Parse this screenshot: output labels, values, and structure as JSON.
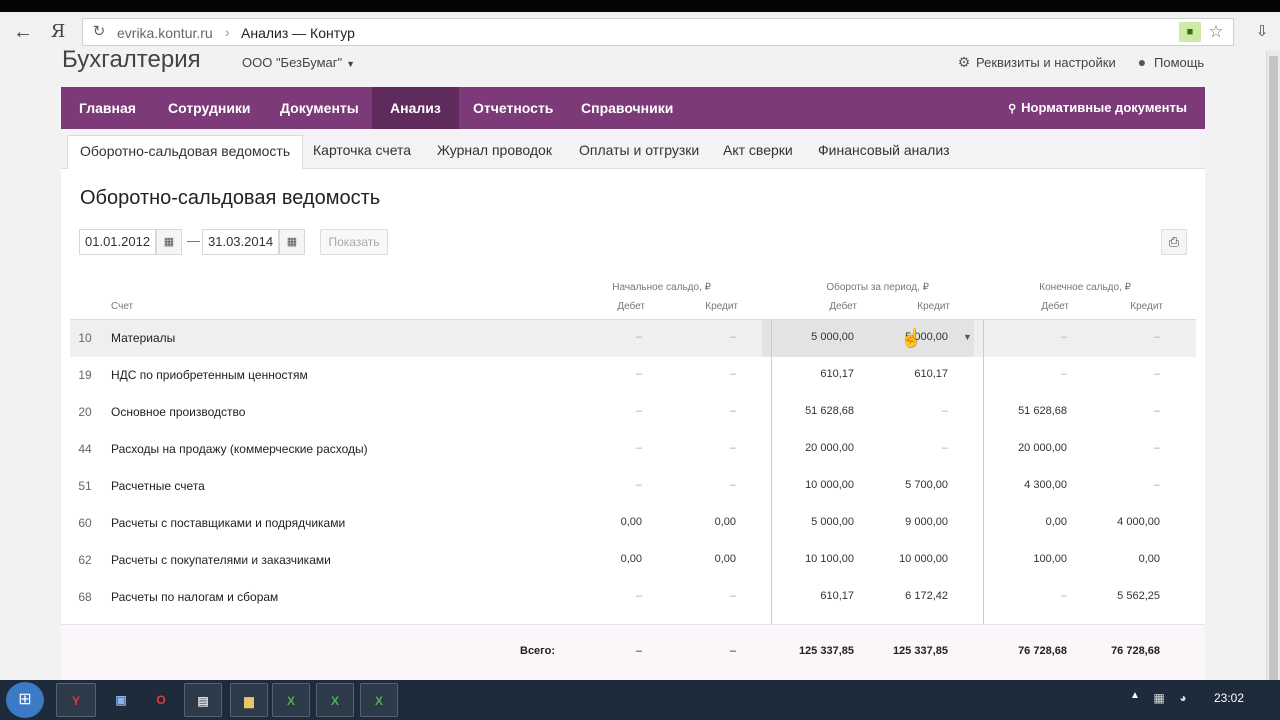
{
  "browser": {
    "url_domain": "evrika.kontur.ru",
    "url_sep": "›",
    "page_title": "Анализ — Контур"
  },
  "header": {
    "app_title": "Бухгалтерия",
    "org": "ООО \"БезБумаг\"",
    "settings": "Реквизиты и настройки",
    "help": "Помощь"
  },
  "mainnav": {
    "items": [
      {
        "label": "Главная"
      },
      {
        "label": "Сотрудники"
      },
      {
        "label": "Документы"
      },
      {
        "label": "Анализ"
      },
      {
        "label": "Отчетность"
      },
      {
        "label": "Справочники"
      }
    ],
    "active": "Анализ",
    "normative": "Нормативные документы"
  },
  "subtabs": [
    {
      "label": "Оборотно-сальдовая ведомость"
    },
    {
      "label": "Карточка счета"
    },
    {
      "label": "Журнал проводок"
    },
    {
      "label": "Оплаты и отгрузки"
    },
    {
      "label": "Акт сверки"
    },
    {
      "label": "Финансовый анализ"
    }
  ],
  "report": {
    "title": "Оборотно-сальдовая ведомость",
    "date_from": "01.01.2012",
    "date_to": "31.03.2014",
    "date_sep": "—",
    "show_label": "Показать"
  },
  "table": {
    "headers": {
      "account": "Счет",
      "opening": "Начальное сальдо, ₽",
      "turnover": "Обороты за период, ₽",
      "closing": "Конечное сальдо, ₽",
      "debit": "Дебет",
      "credit": "Кредит"
    },
    "rows": [
      {
        "code": "10",
        "name": "Материалы",
        "od": "–",
        "oc": "–",
        "td": "5 000,00",
        "tc": "5 000,00",
        "cd": "–",
        "cc": "–"
      },
      {
        "code": "19",
        "name": "НДС по приобретенным ценностям",
        "od": "–",
        "oc": "–",
        "td": "610,17",
        "tc": "610,17",
        "cd": "–",
        "cc": "–"
      },
      {
        "code": "20",
        "name": "Основное производство",
        "od": "–",
        "oc": "–",
        "td": "51 628,68",
        "tc": "–",
        "cd": "51 628,68",
        "cc": "–"
      },
      {
        "code": "44",
        "name": "Расходы на продажу (коммерческие расходы)",
        "od": "–",
        "oc": "–",
        "td": "20 000,00",
        "tc": "–",
        "cd": "20 000,00",
        "cc": "–"
      },
      {
        "code": "51",
        "name": "Расчетные счета",
        "od": "–",
        "oc": "–",
        "td": "10 000,00",
        "tc": "5 700,00",
        "cd": "4 300,00",
        "cc": "–"
      },
      {
        "code": "60",
        "name": "Расчеты с поставщиками и подрядчиками",
        "od": "0,00",
        "oc": "0,00",
        "td": "5 000,00",
        "tc": "9 000,00",
        "cd": "0,00",
        "cc": "4 000,00"
      },
      {
        "code": "62",
        "name": "Расчеты с покупателями и заказчиками",
        "od": "0,00",
        "oc": "0,00",
        "td": "10 100,00",
        "tc": "10 000,00",
        "cd": "100,00",
        "cc": "0,00"
      },
      {
        "code": "68",
        "name": "Расчеты по налогам и сборам",
        "od": "–",
        "oc": "–",
        "td": "610,17",
        "tc": "6 172,42",
        "cd": "–",
        "cc": "5 562,25"
      }
    ],
    "totals": {
      "label": "Всего:",
      "od": "–",
      "oc": "–",
      "td": "125 337,85",
      "tc": "125 337,85",
      "cd": "76 728,68",
      "cc": "76 728,68"
    }
  },
  "taskbar": {
    "clock": "23:02"
  }
}
